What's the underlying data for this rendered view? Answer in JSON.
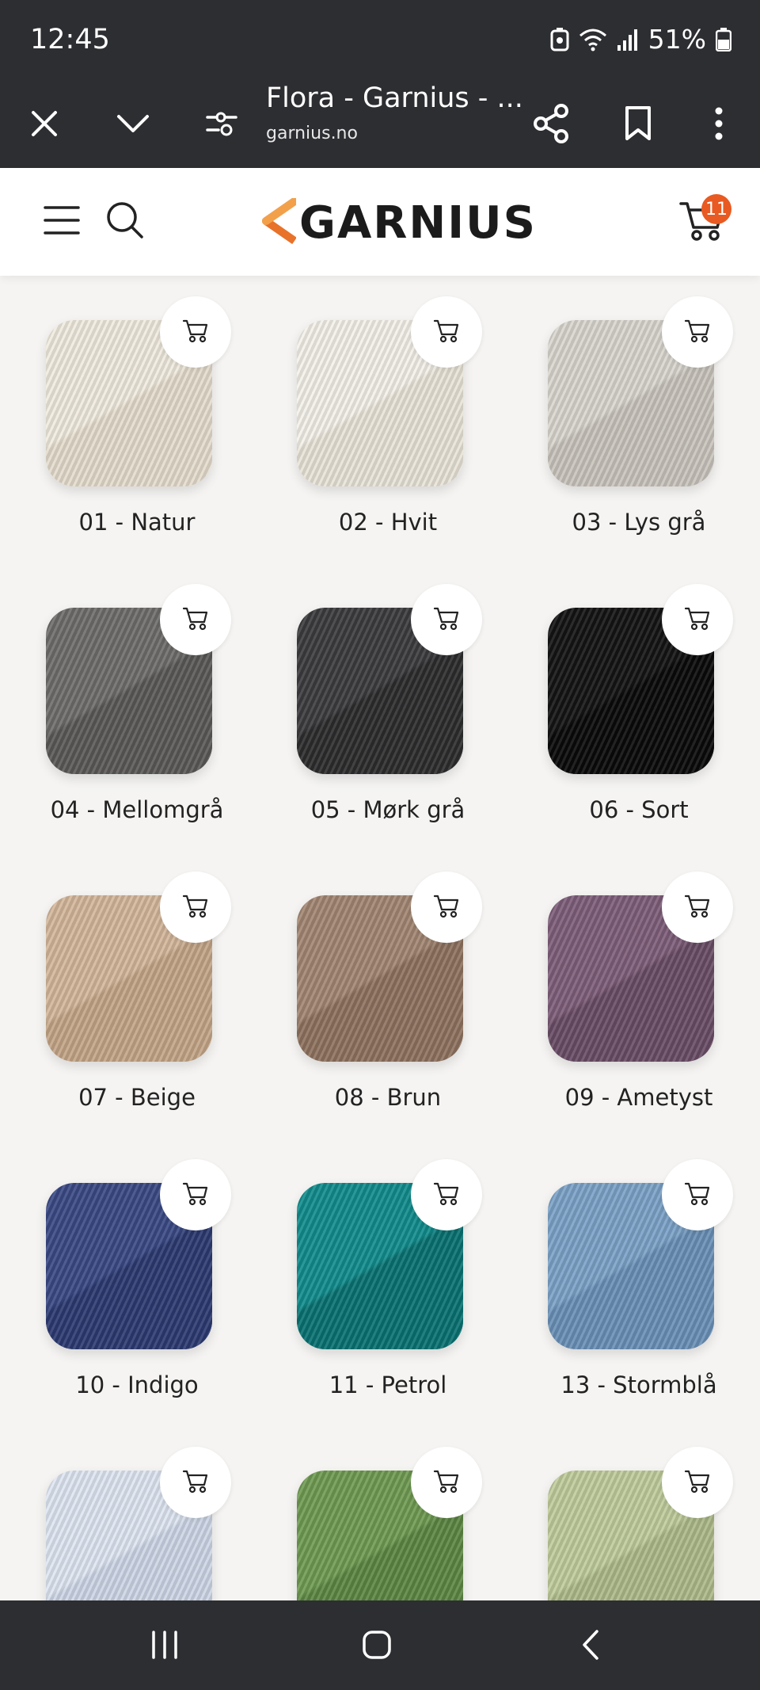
{
  "status_bar": {
    "time": "12:45",
    "battery_percent": "51%"
  },
  "browser": {
    "title": "Flora - Garnius - ...",
    "url": "garnius.no"
  },
  "site": {
    "logo_text": "GARNIUS",
    "cart_count": "11"
  },
  "products": [
    {
      "label": "01 - Natur",
      "color": "#f1ebdf",
      "shade": "#e4dccd"
    },
    {
      "label": "02 - Hvit",
      "color": "#f4f1ea",
      "shade": "#e8e3d8"
    },
    {
      "label": "03 - Lys grå",
      "color": "#d9d6cf",
      "shade": "#c8c4bc"
    },
    {
      "label": "04 - Mellomgrå",
      "color": "#6e6d6b",
      "shade": "#5a5958"
    },
    {
      "label": "05 - Mørk grå",
      "color": "#3c3c3e",
      "shade": "#2c2c2e"
    },
    {
      "label": "06 - Sort",
      "color": "#141414",
      "shade": "#0a0a0a"
    },
    {
      "label": "07 - Beige",
      "color": "#d3b79b",
      "shade": "#c3a587"
    },
    {
      "label": "08 - Brun",
      "color": "#a38773",
      "shade": "#8e725f"
    },
    {
      "label": "09 - Ametyst",
      "color": "#7e5e79",
      "shade": "#6a4d66"
    },
    {
      "label": "10 - Indigo",
      "color": "#3a4a86",
      "shade": "#2c3a70"
    },
    {
      "label": "11 - Petrol",
      "color": "#128c8c",
      "shade": "#0a7272"
    },
    {
      "label": "13 - Stormblå",
      "color": "#7ca2c7",
      "shade": "#6a90b6"
    },
    {
      "label": "",
      "color": "#dfe6f2",
      "shade": "#cdd6e6"
    },
    {
      "label": "",
      "color": "#6f9b52",
      "shade": "#5d8744"
    },
    {
      "label": "",
      "color": "#bfcc9c",
      "shade": "#adba89"
    }
  ]
}
